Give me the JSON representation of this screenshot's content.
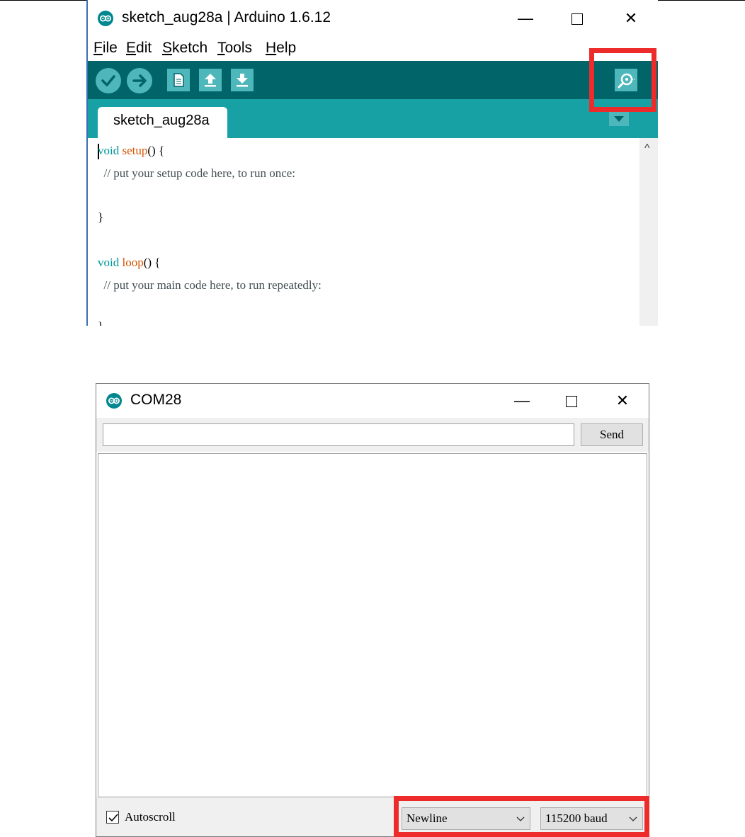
{
  "ide": {
    "window_title": "sketch_aug28a | Arduino 1.6.12",
    "window_controls": {
      "minimize": "—",
      "close": "✕"
    },
    "menu": [
      {
        "first": "F",
        "rest": "ile"
      },
      {
        "first": "E",
        "rest": "dit"
      },
      {
        "first": "S",
        "rest": "ketch"
      },
      {
        "first": "T",
        "rest": "ools"
      },
      {
        "first": "H",
        "rest": "elp"
      }
    ],
    "toolbar": {
      "icons": [
        "verify-icon",
        "upload-icon",
        "new-icon",
        "open-icon",
        "save-icon",
        "serial-monitor-icon"
      ]
    },
    "tab_label": "sketch_aug28a",
    "code": [
      {
        "kw": "void",
        "fn": "setup",
        "rest": "() {"
      },
      {
        "comment": "  // put your setup code here, to run once:"
      },
      {
        "plain": "}"
      },
      {
        "kw": "void",
        "fn": "loop",
        "rest": "() {"
      },
      {
        "comment": "  // put your main code here, to run repeatedly:"
      },
      {
        "plain": "}"
      }
    ],
    "scroll_up_glyph": "^"
  },
  "serial": {
    "title": "COM28",
    "window_controls": {
      "minimize": "—",
      "close": "✕"
    },
    "input_value": "",
    "send_label": "Send",
    "autoscroll_label": "Autoscroll",
    "autoscroll_checked": true,
    "line_ending": "Newline",
    "baud": "115200 baud"
  },
  "colors": {
    "toolbar": "#006468",
    "tabbar": "#17a1a5",
    "button": "#4db7bb",
    "highlight": "#ee2b2b"
  }
}
